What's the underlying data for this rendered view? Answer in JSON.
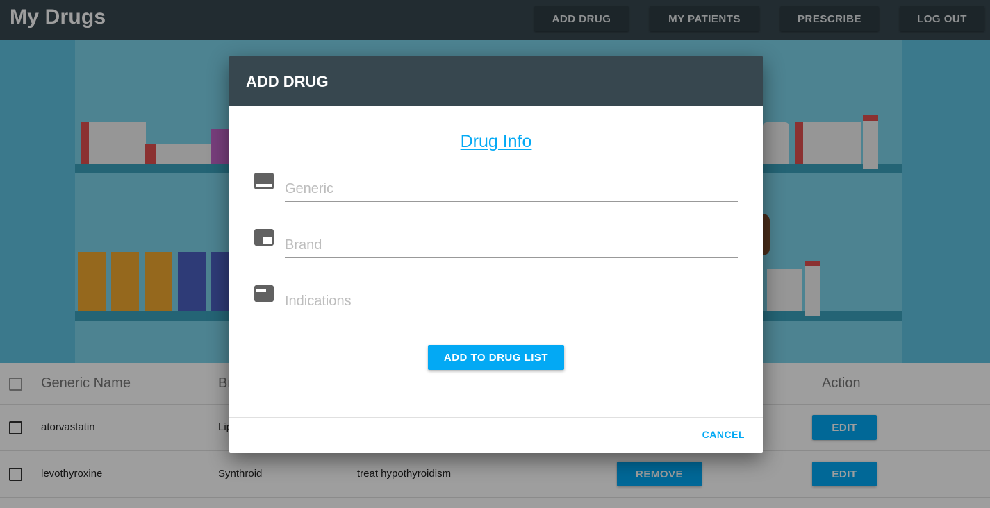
{
  "app": {
    "title": "My Drugs",
    "nav": {
      "add_drug": "ADD DRUG",
      "my_patients": "MY PATIENTS",
      "prescribe": "PRESCRIBE",
      "log_out": "LOG OUT"
    }
  },
  "table": {
    "headers": {
      "generic": "Generic Name",
      "brand": "Br",
      "action": "Action"
    },
    "rows": [
      {
        "generic": "atorvastatin",
        "brand": "Lip",
        "indication": "",
        "remove": "",
        "edit": "EDIT"
      },
      {
        "generic": "levothyroxine",
        "brand": "Synthroid",
        "indication": "treat hypothyroidism",
        "remove": "REMOVE",
        "edit": "EDIT"
      }
    ]
  },
  "dialog": {
    "title": "ADD DRUG",
    "section_title": "Drug Info",
    "fields": {
      "generic": {
        "placeholder": "Generic",
        "icon": "subtitles-icon"
      },
      "brand": {
        "placeholder": "Brand",
        "icon": "picture-in-picture-icon"
      },
      "indications": {
        "placeholder": "Indications",
        "icon": "card-text-icon"
      }
    },
    "submit_label": "ADD TO DRUG LIST",
    "cancel_label": "CANCEL"
  },
  "colors": {
    "appbar": "#37474f",
    "accent": "#03a9f4",
    "hero": "#5fc4e2"
  }
}
